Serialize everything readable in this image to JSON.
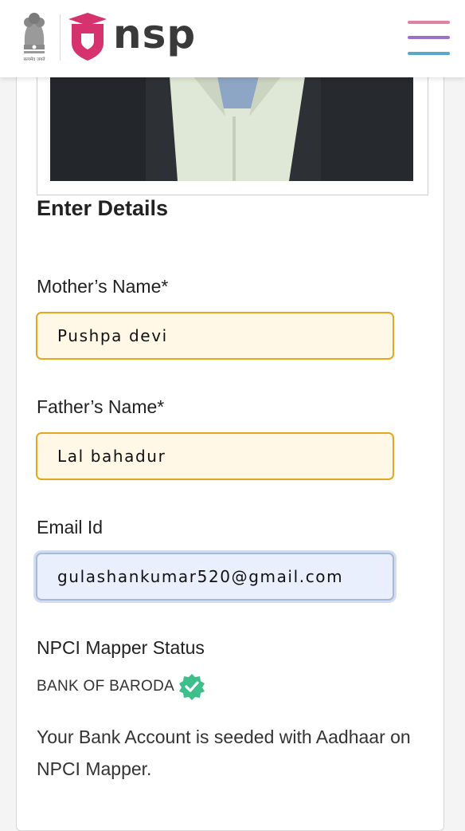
{
  "header": {
    "emblem_caption": "सत्यमेव जयते",
    "brand": "nsp",
    "colors": {
      "brand_pink": "#d6326d",
      "menu": [
        "#e083a0",
        "#9a73c8",
        "#5aa8c7"
      ]
    }
  },
  "details": {
    "title": "Enter Details",
    "mother": {
      "label": "Mother’s Name*",
      "value": "Pushpa devi"
    },
    "father": {
      "label": "Father’s Name*",
      "value": "Lal bahadur"
    },
    "email": {
      "label": "Email Id",
      "value": "gulashankumar520@gmail.com"
    },
    "npci": {
      "title": "NPCI Mapper Status",
      "bank": "BANK OF BARODA",
      "verified_icon": "verified-badge",
      "message": "Your Bank Account is seeded with Aadhaar on NPCI Mapper."
    }
  }
}
